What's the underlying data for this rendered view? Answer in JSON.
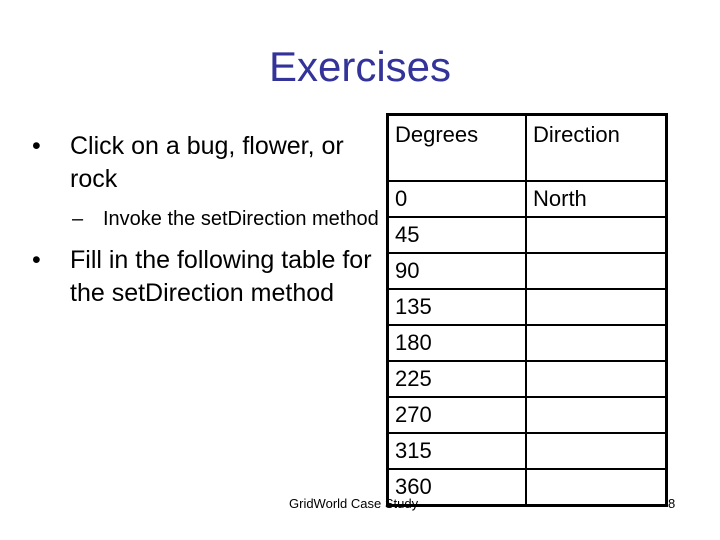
{
  "slide": {
    "title": "Exercises",
    "bullets": [
      {
        "marker": "•",
        "text": "Click on a bug, flower, or rock",
        "sub": [
          {
            "marker": "–",
            "text": "Invoke the setDirection method"
          }
        ]
      },
      {
        "marker": "•",
        "text": "Fill in the following table for the setDirection method",
        "sub": []
      }
    ],
    "table": {
      "headers": [
        "Degrees",
        "Direction"
      ],
      "rows": [
        [
          "0",
          "North"
        ],
        [
          "45",
          ""
        ],
        [
          "90",
          ""
        ],
        [
          "135",
          ""
        ],
        [
          "180",
          ""
        ],
        [
          "225",
          ""
        ],
        [
          "270",
          ""
        ],
        [
          "315",
          ""
        ],
        [
          "360",
          ""
        ]
      ]
    },
    "footer": "GridWorld Case Study",
    "page_number": "8",
    "colors": {
      "title": "#333399",
      "text": "#000000",
      "background": "#ffffff"
    }
  }
}
